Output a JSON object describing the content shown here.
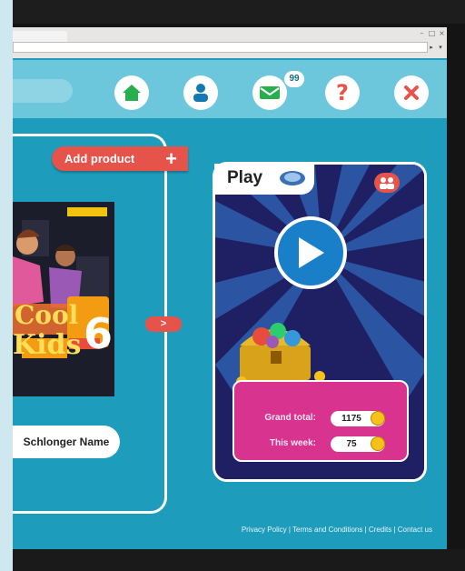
{
  "topbar": {
    "mail_badge": "99",
    "icons": [
      "home-icon",
      "user-icon",
      "mail-icon",
      "help-icon",
      "close-icon"
    ]
  },
  "left_panel": {
    "add_product_label": "Add product",
    "book_title_top": "Cool",
    "book_title_bottom": "Kids",
    "book_number": "6",
    "name_label": "Schlonger Name"
  },
  "play_panel": {
    "title": "Play",
    "grand_total_label": "Grand total:",
    "grand_total_value": "1175",
    "this_week_label": "This week:",
    "this_week_value": "75"
  },
  "footer": {
    "links_text": "Privacy Policy | Terms and Conditions | Credits | Contact us"
  },
  "colors": {
    "app_background": "#1e9cbc",
    "topbar": "#6cc6dc",
    "accent_red": "#e5534b",
    "points_card": "#d8338e",
    "play_panel": "#1f1f63"
  }
}
